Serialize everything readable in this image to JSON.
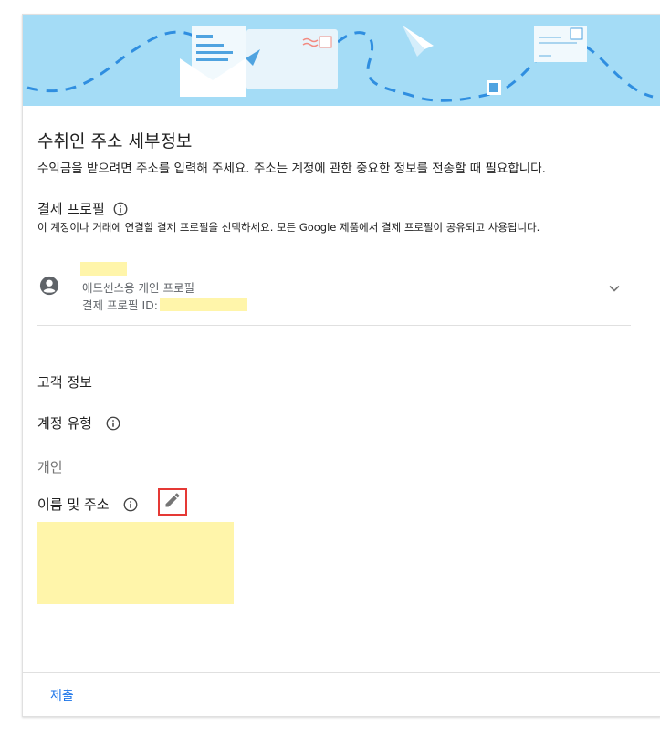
{
  "page": {
    "title": "수취인 주소 세부정보",
    "subtitle": "수익금을 받으려면 주소를 입력해 주세요. 주소는 계정에 관한 중요한 정보를 전송할 때 필요합니다."
  },
  "payments_profile": {
    "label": "결제 프로필",
    "description": "이 계정이나 거래에 연결할 결제 프로필을 선택하세요. 모든 Google 제품에서 결제 프로필이 공유되고 사용됩니다.",
    "profile_type": "애드센스용 개인 프로필",
    "profile_id_label": "결제 프로필 ID:"
  },
  "customer_info": {
    "heading": "고객 정보",
    "account_type_label": "계정 유형",
    "account_type_value": "개인",
    "name_address_label": "이름 및 주소"
  },
  "footer": {
    "submit_label": "제출"
  },
  "icons": {
    "info": "info-icon",
    "person": "account-circle-icon",
    "chevron": "chevron-down-icon",
    "edit": "pencil-icon"
  },
  "colors": {
    "banner": "#a4dcf6",
    "link": "#1a73e8",
    "redaction": "#fff5aa",
    "highlight_box": "#e53935"
  }
}
